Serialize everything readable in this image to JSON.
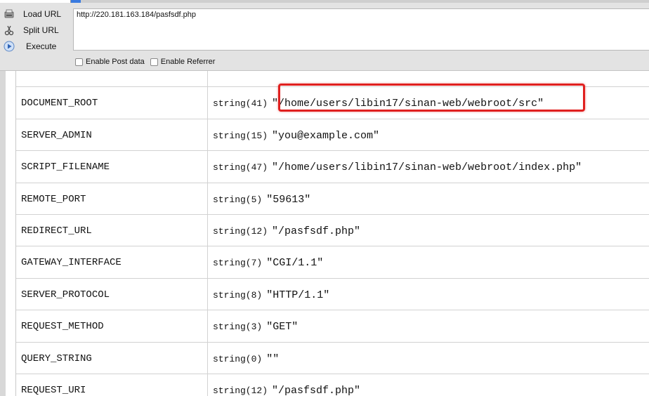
{
  "toolbar": {
    "actions": [
      {
        "label": "Load URL",
        "icon": "load-url-icon"
      },
      {
        "label": "Split URL",
        "icon": "split-url-icon"
      },
      {
        "label": "Execute",
        "icon": "execute-icon"
      }
    ],
    "url_value": "http://220.181.163.184/pasfsdf.php",
    "options": [
      {
        "label": "Enable Post data",
        "checked": false
      },
      {
        "label": "Enable Referrer",
        "checked": false
      }
    ],
    "accent_color": "#3a7be0"
  },
  "rows": [
    {
      "key": "",
      "type": "",
      "value": ""
    },
    {
      "key": "DOCUMENT_ROOT",
      "type": "string(41)",
      "value": "\"/home/users/libin17/sinan-web/webroot/src\""
    },
    {
      "key": "SERVER_ADMIN",
      "type": "string(15)",
      "value": "\"you@example.com\""
    },
    {
      "key": "SCRIPT_FILENAME",
      "type": "string(47)",
      "value": "\"/home/users/libin17/sinan-web/webroot/index.php\""
    },
    {
      "key": "REMOTE_PORT",
      "type": "string(5)",
      "value": "\"59613\""
    },
    {
      "key": "REDIRECT_URL",
      "type": "string(12)",
      "value": "\"/pasfsdf.php\""
    },
    {
      "key": "GATEWAY_INTERFACE",
      "type": "string(7)",
      "value": "\"CGI/1.1\""
    },
    {
      "key": "SERVER_PROTOCOL",
      "type": "string(8)",
      "value": "\"HTTP/1.1\""
    },
    {
      "key": "REQUEST_METHOD",
      "type": "string(3)",
      "value": "\"GET\""
    },
    {
      "key": "QUERY_STRING",
      "type": "string(0)",
      "value": "\"\""
    },
    {
      "key": "REQUEST_URI",
      "type": "string(12)",
      "value": "\"/pasfsdf.php\""
    }
  ],
  "highlight_color": "#e0201f"
}
